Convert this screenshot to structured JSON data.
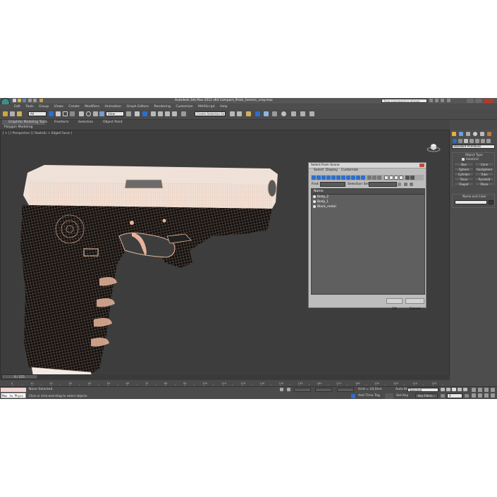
{
  "app": {
    "title": "Autodesk 3ds Max  2012 x64     Compact_Pistol_Generic_vray.max",
    "search_placeholder": "Type a keyword or phrase",
    "menu": [
      "Edit",
      "Tools",
      "Group",
      "Views",
      "Create",
      "Modifiers",
      "Animation",
      "Graph Editors",
      "Rendering",
      "Customize",
      "MAXScript",
      "Help"
    ],
    "toolbar": {
      "filter_value": "All",
      "view_value": "View",
      "selection_set_placeholder": "Create Selection Se"
    }
  },
  "ribbon": {
    "tabs": [
      "Graphite Modeling Tools",
      "Freeform",
      "Selection",
      "Object Paint"
    ],
    "subtitle": "Polygon Modeling"
  },
  "viewport": {
    "label": "[ + ] [ Perspective ] [ Realistic + Edged Faces ]"
  },
  "dialog": {
    "title": "Select From Scene",
    "tabs": [
      "Select",
      "Display",
      "Customize"
    ],
    "find_label": "Find:",
    "selection_set_label": "Selection Set:",
    "column_header": "Name",
    "items": [
      "Body_2",
      "Body_1",
      "Black_metal"
    ],
    "ok_label": "OK",
    "cancel_label": "Cancel"
  },
  "command_panel": {
    "category_dropdown": "Standard Primitives",
    "object_type_header": "Object Type",
    "autogrid_label": "AutoGrid",
    "primitives": [
      "Box",
      "Cone",
      "Sphere",
      "GeoSphere",
      "Cylinder",
      "Tube",
      "Torus",
      "Pyramid",
      "Teapot",
      "Plane"
    ],
    "name_color_header": "Name and Color"
  },
  "timeline": {
    "frame_counter": "0 / 225",
    "ticks": [
      "0",
      "10",
      "20",
      "30",
      "40",
      "50",
      "60",
      "70",
      "80",
      "90",
      "100",
      "110",
      "120",
      "130",
      "140",
      "150",
      "160",
      "170",
      "180",
      "190",
      "200",
      "210",
      "220"
    ]
  },
  "status": {
    "script_text": "Max to Physc",
    "none_selected": "None Selected",
    "prompt": "Click or click-and-drag to select objects",
    "grid": "Grid = 10,0cm",
    "add_time_tag": "Add Time Tag",
    "auto_key": "Auto Key",
    "set_key": "Set Key",
    "key_mode_value": "Selected",
    "key_filters": "Key Filters...",
    "frame_value": "0"
  },
  "colors": {
    "app_bg": "#4a4a4a",
    "viewport_bg": "#3d3d3d",
    "wire_color": "#e6b49a",
    "accent": "#1d6fd6"
  }
}
